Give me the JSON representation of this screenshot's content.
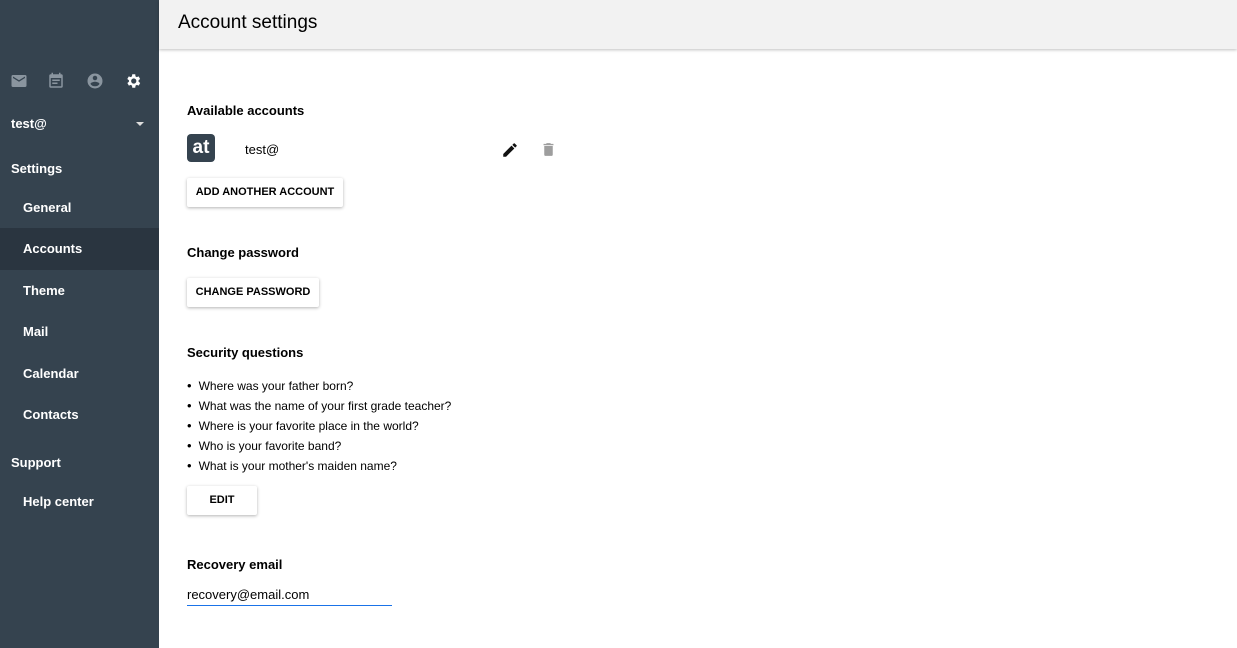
{
  "sidebar": {
    "nav_icons": [
      "mail-icon",
      "calendar-icon",
      "contacts-icon",
      "settings-icon"
    ],
    "account": "test@",
    "settings_heading": "Settings",
    "items": [
      {
        "label": "General"
      },
      {
        "label": "Accounts",
        "active": true
      },
      {
        "label": "Theme"
      },
      {
        "label": "Mail"
      },
      {
        "label": "Calendar"
      },
      {
        "label": "Contacts"
      }
    ],
    "support_heading": "Support",
    "support_items": [
      {
        "label": "Help center"
      }
    ],
    "bg": "#35434f"
  },
  "header": {
    "title": "Account settings"
  },
  "available": {
    "heading": "Available accounts",
    "logo_text": "at",
    "account": "test@",
    "add_button": "ADD ANOTHER ACCOUNT"
  },
  "password": {
    "heading": "Change password",
    "button": "CHANGE PASSWORD"
  },
  "security": {
    "heading": "Security questions",
    "questions": [
      "Where was your father born?",
      "What was the name of your first grade teacher?",
      "Where is your favorite place in the world?",
      "Who is your favorite band?",
      "What is your mother's maiden name?"
    ],
    "button": "EDIT"
  },
  "recovery": {
    "heading": "Recovery email",
    "value": "recovery@email.com"
  }
}
